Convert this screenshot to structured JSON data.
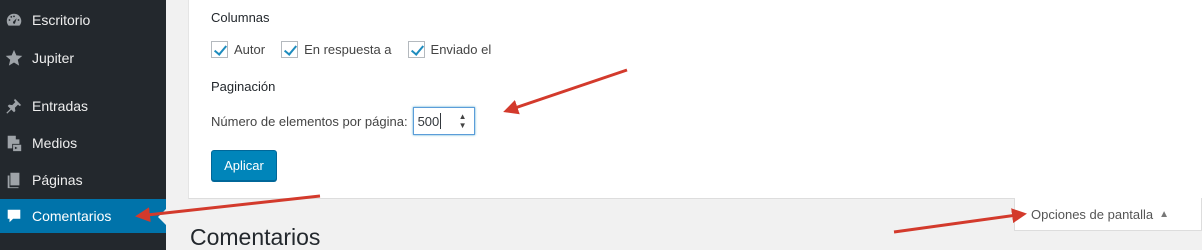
{
  "sidebar": {
    "items": [
      {
        "label": "Escritorio",
        "icon": "dashboard-icon"
      },
      {
        "label": "Jupiter",
        "icon": "star-icon"
      },
      {
        "label": "Entradas",
        "icon": "pushpin-icon"
      },
      {
        "label": "Medios",
        "icon": "media-icon"
      },
      {
        "label": "Páginas",
        "icon": "pages-icon"
      },
      {
        "label": "Comentarios",
        "icon": "comment-icon",
        "active": true
      }
    ]
  },
  "screen_options": {
    "columns_title": "Columnas",
    "columns": [
      {
        "label": "Autor",
        "checked": true
      },
      {
        "label": "En respuesta a",
        "checked": true
      },
      {
        "label": "Enviado el",
        "checked": true
      }
    ],
    "pagination_title": "Paginación",
    "per_page_label": "Número de elementos por página:",
    "per_page_value": "500",
    "apply_label": "Aplicar"
  },
  "screen_options_tab": {
    "label": "Opciones de pantalla",
    "icon": "triangle-up-icon"
  },
  "page_title": "Comentarios",
  "colors": {
    "sidebar_bg": "#23282d",
    "active_bg": "#0073aa",
    "button_bg": "#0085ba",
    "annotation_arrow": "#d33a2c"
  }
}
